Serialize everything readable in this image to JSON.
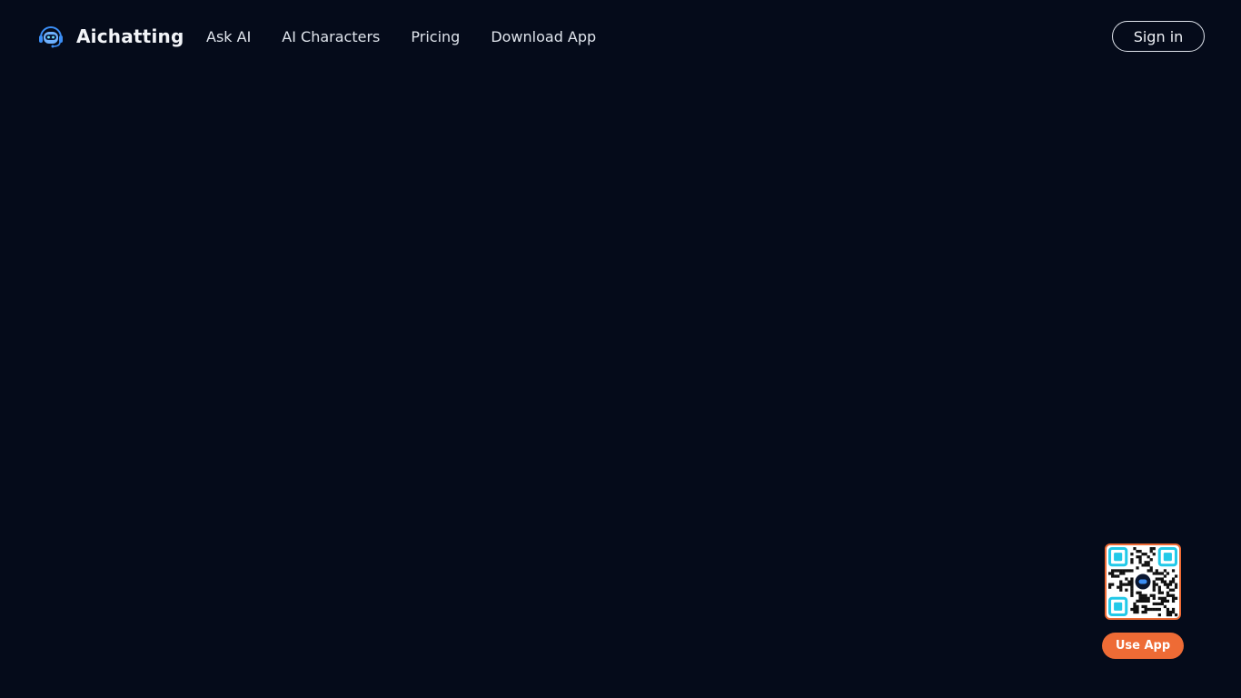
{
  "header": {
    "brand_name": "Aichatting",
    "logo_icon": "robot-headset-icon",
    "nav": [
      {
        "label": "Ask AI"
      },
      {
        "label": "AI Characters"
      },
      {
        "label": "Pricing"
      },
      {
        "label": "Download App"
      }
    ],
    "sign_in_label": "Sign in"
  },
  "app_promo": {
    "qr_icon": "qr-code-icon",
    "use_app_label": "Use App"
  },
  "colors": {
    "background": "#050b1a",
    "accent": "#ee6b35",
    "logo_blue": "#3b8ef5",
    "qr_corner": "#22c9e8"
  }
}
